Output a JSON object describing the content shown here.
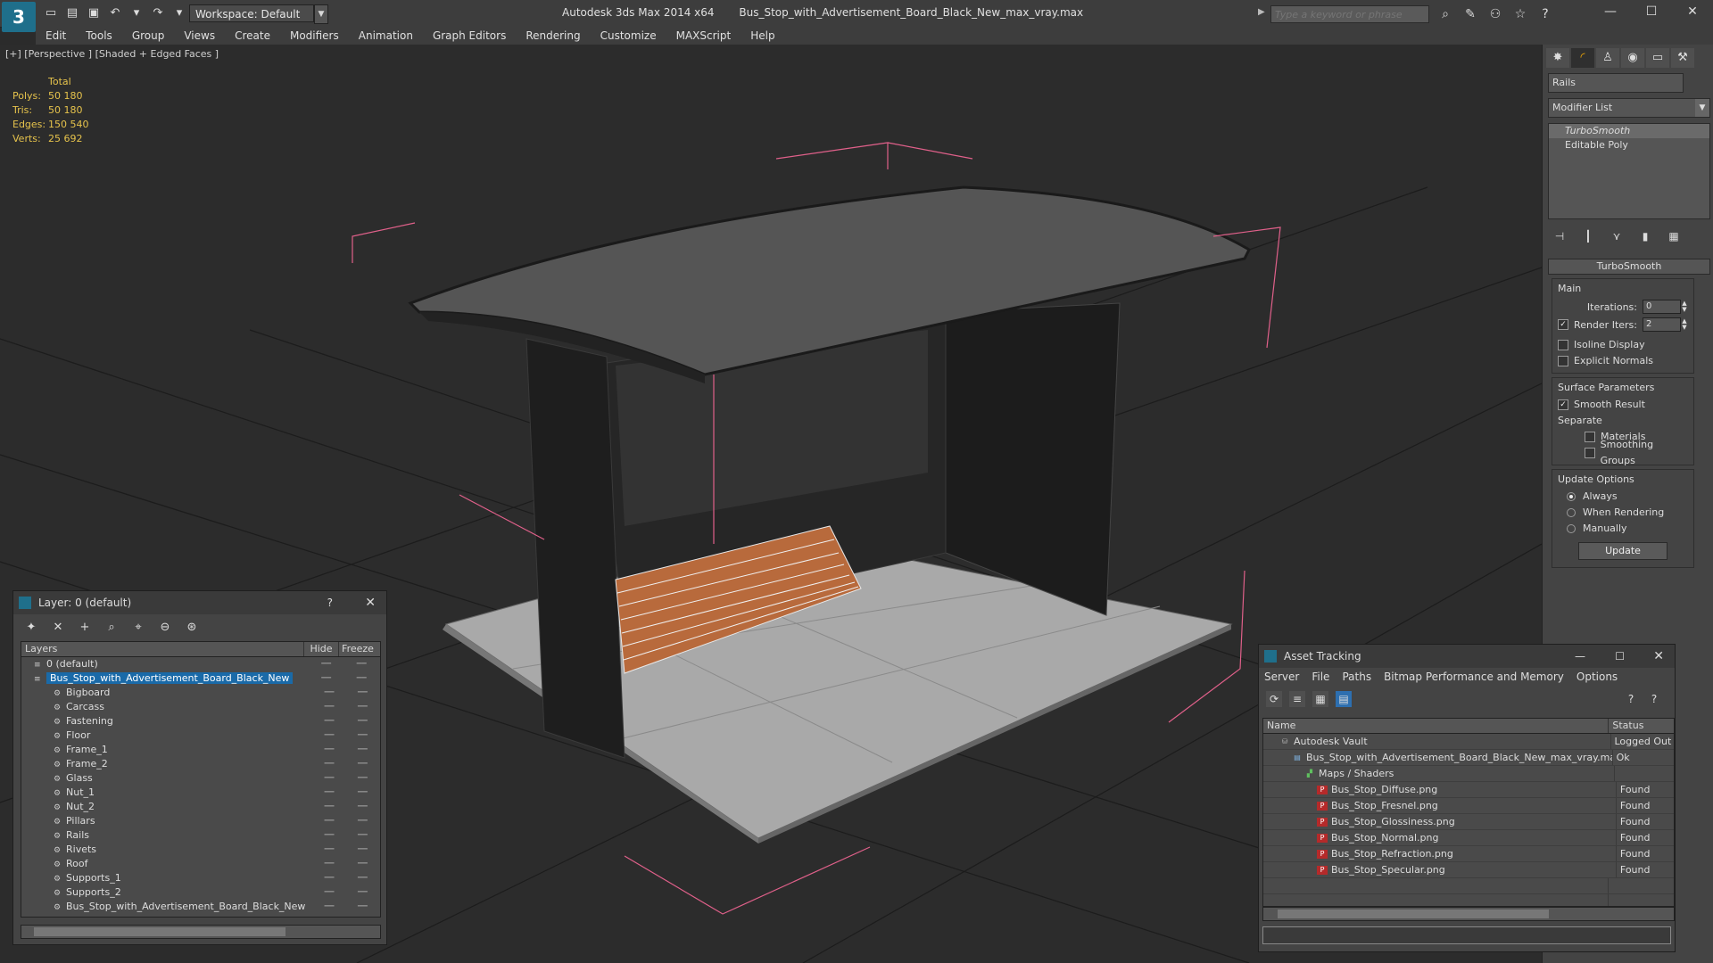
{
  "title_bar": {
    "app_name": "Autodesk 3ds Max  2014 x64",
    "file_name": "Bus_Stop_with_Advertisement_Board_Black_New_max_vray.max",
    "workspace": "Workspace: Default",
    "search_placeholder": "Type a keyword or phrase"
  },
  "menu": [
    "Edit",
    "Tools",
    "Group",
    "Views",
    "Create",
    "Modifiers",
    "Animation",
    "Graph Editors",
    "Rendering",
    "Customize",
    "MAXScript",
    "Help"
  ],
  "viewport": {
    "label": "[+] [Perspective ] [Shaded + Edged Faces ]",
    "stats_header": "Total",
    "stats": [
      {
        "label": "Polys:",
        "value": "50 180"
      },
      {
        "label": "Tris:",
        "value": "50 180"
      },
      {
        "label": "Edges:",
        "value": "150 540"
      },
      {
        "label": "Verts:",
        "value": "25 692"
      }
    ]
  },
  "command_panel": {
    "object_name": "Rails",
    "modifier_list": "Modifier List",
    "stack": [
      {
        "label": "TurboSmooth",
        "selected": true
      },
      {
        "label": "Editable Poly",
        "selected": false
      }
    ],
    "rollout_title": "TurboSmooth",
    "main_label": "Main",
    "iterations_label": "Iterations:",
    "iterations_value": "0",
    "render_iters_label": "Render Iters:",
    "render_iters_value": "2",
    "isoline_label": "Isoline Display",
    "explicit_normals_label": "Explicit Normals",
    "surface_params_label": "Surface Parameters",
    "smooth_result_label": "Smooth Result",
    "separate_label": "Separate",
    "materials_label": "Materials",
    "smoothing_groups_label": "Smoothing Groups",
    "update_options_label": "Update Options",
    "always_label": "Always",
    "when_rendering_label": "When Rendering",
    "manually_label": "Manually",
    "update_button": "Update"
  },
  "layer_dialog": {
    "title": "Layer: 0 (default)",
    "col_layers": "Layers",
    "col_hide": "Hide",
    "col_freeze": "Freeze",
    "rows": [
      {
        "name": "0 (default)",
        "level": 0,
        "selected": false
      },
      {
        "name": "Bus_Stop_with_Advertisement_Board_Black_New",
        "level": 0,
        "selected": true
      },
      {
        "name": "Bigboard",
        "level": 1,
        "selected": false
      },
      {
        "name": "Carcass",
        "level": 1,
        "selected": false
      },
      {
        "name": "Fastening",
        "level": 1,
        "selected": false
      },
      {
        "name": "Floor",
        "level": 1,
        "selected": false
      },
      {
        "name": "Frame_1",
        "level": 1,
        "selected": false
      },
      {
        "name": "Frame_2",
        "level": 1,
        "selected": false
      },
      {
        "name": "Glass",
        "level": 1,
        "selected": false
      },
      {
        "name": "Nut_1",
        "level": 1,
        "selected": false
      },
      {
        "name": "Nut_2",
        "level": 1,
        "selected": false
      },
      {
        "name": "Pillars",
        "level": 1,
        "selected": false
      },
      {
        "name": "Rails",
        "level": 1,
        "selected": false
      },
      {
        "name": "Rivets",
        "level": 1,
        "selected": false
      },
      {
        "name": "Roof",
        "level": 1,
        "selected": false
      },
      {
        "name": "Supports_1",
        "level": 1,
        "selected": false
      },
      {
        "name": "Supports_2",
        "level": 1,
        "selected": false
      },
      {
        "name": "Bus_Stop_with_Advertisement_Board_Black_New",
        "level": 1,
        "selected": false
      }
    ]
  },
  "asset_tracking": {
    "title": "Asset Tracking",
    "menu": [
      "Server",
      "File",
      "Paths",
      "Bitmap Performance and Memory",
      "Options"
    ],
    "col_name": "Name",
    "col_status": "Status",
    "rows": [
      {
        "name": "Autodesk Vault",
        "status": "Logged Out",
        "level": 0,
        "icon": "vault"
      },
      {
        "name": "Bus_Stop_with_Advertisement_Board_Black_New_max_vray.max",
        "status": "Ok",
        "level": 1,
        "icon": "max"
      },
      {
        "name": "Maps / Shaders",
        "status": "",
        "level": 2,
        "icon": "maps"
      },
      {
        "name": "Bus_Stop_Diffuse.png",
        "status": "Found",
        "level": 3,
        "icon": "png"
      },
      {
        "name": "Bus_Stop_Fresnel.png",
        "status": "Found",
        "level": 3,
        "icon": "png"
      },
      {
        "name": "Bus_Stop_Glossiness.png",
        "status": "Found",
        "level": 3,
        "icon": "png"
      },
      {
        "name": "Bus_Stop_Normal.png",
        "status": "Found",
        "level": 3,
        "icon": "png"
      },
      {
        "name": "Bus_Stop_Refraction.png",
        "status": "Found",
        "level": 3,
        "icon": "png"
      },
      {
        "name": "Bus_Stop_Specular.png",
        "status": "Found",
        "level": 3,
        "icon": "png"
      }
    ]
  },
  "colors": {
    "accent_select": "#1a6aa8",
    "stats_text": "#e6c34c",
    "bbox": "#e0608a"
  }
}
